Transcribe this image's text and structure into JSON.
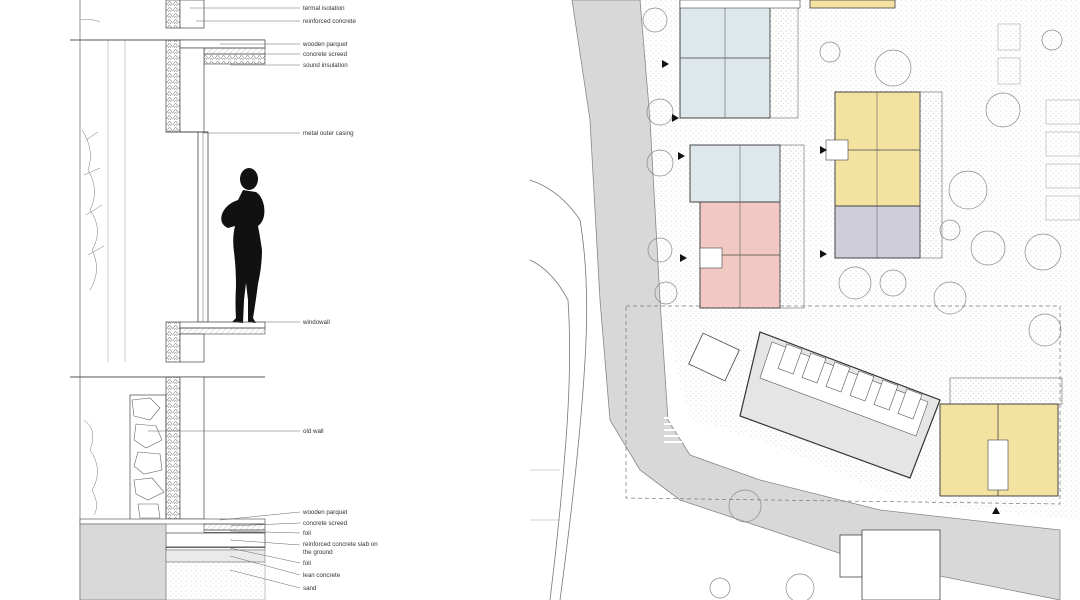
{
  "section": {
    "labels": {
      "thermal_isolation": "termal isolation",
      "reinforced_concrete_top": "reinforced concrete",
      "wooden_parquet_top": "wooden parquet",
      "concrete_screed_top": "concrete screed",
      "sound_insulation": "sound insulation",
      "metal_outer_casing": "metal outer casing",
      "windowall": "windowall",
      "old_wall": "old wall",
      "wooden_parquet_bottom": "wooden parquet",
      "concrete_screed_bottom": "concrete screed",
      "foil_top": "foil",
      "slab_line1": "reinforced concrete slab on",
      "slab_line2": "the ground",
      "foil_bottom": "foil",
      "lean_concrete": "lean concrete",
      "sand": "sand"
    }
  },
  "colors": {
    "line": "#555555",
    "light_line": "#9a9a9a",
    "yellow_units": "#f3e2a0",
    "pink_units": "#f2c9c2",
    "blue_units": "#dde7ec",
    "grey_units": "#cfcdd8",
    "silhouette": "#111111"
  }
}
